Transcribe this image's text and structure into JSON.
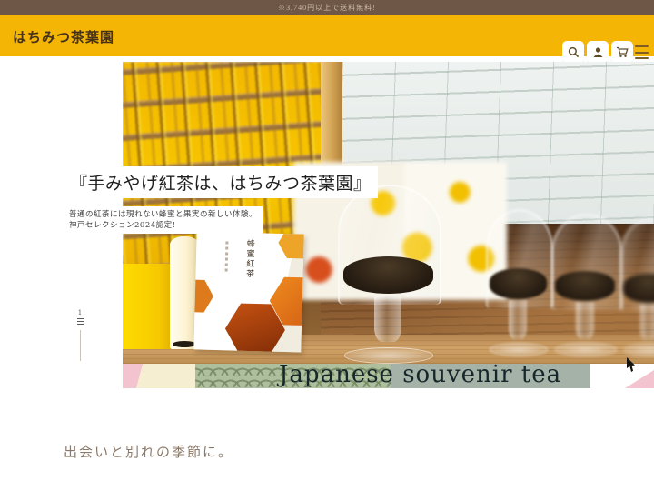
{
  "announcement": {
    "text": "※3,740円以上で送料無料!"
  },
  "header": {
    "brand": "はちみつ茶葉園",
    "icons": [
      {
        "name": "search-icon",
        "label": "検索"
      },
      {
        "name": "account-icon",
        "label": "アカウント"
      },
      {
        "name": "cart-icon",
        "label": "カート"
      },
      {
        "name": "menu-icon",
        "label": "メニュー"
      }
    ]
  },
  "hero": {
    "heading": "『手みやげ紅茶は、はちみつ茶葉園』",
    "sub1": "普通の紅茶には現れない蜂蜜と果実の新しい体験。",
    "sub2": "神戸セレクション2024認定!",
    "banner": "Japanese souvenir tea",
    "slide": "1",
    "product_label": "蜂蜜紅茶"
  },
  "lead": {
    "text": "出会いと別れの季節に。"
  },
  "colors": {
    "topbar_bg": "#6e5747",
    "header_bg": "#f4b504",
    "brand_text": "#44311b",
    "accent_yellow": "#f7c600",
    "banner_text": "#16272b",
    "lead_text": "#8a7868",
    "band_pink": "#f4c3d0",
    "band_cream": "#f6eed0",
    "band_gray": "#a4b2a7",
    "seigaiha_green": "#aebf9e"
  }
}
